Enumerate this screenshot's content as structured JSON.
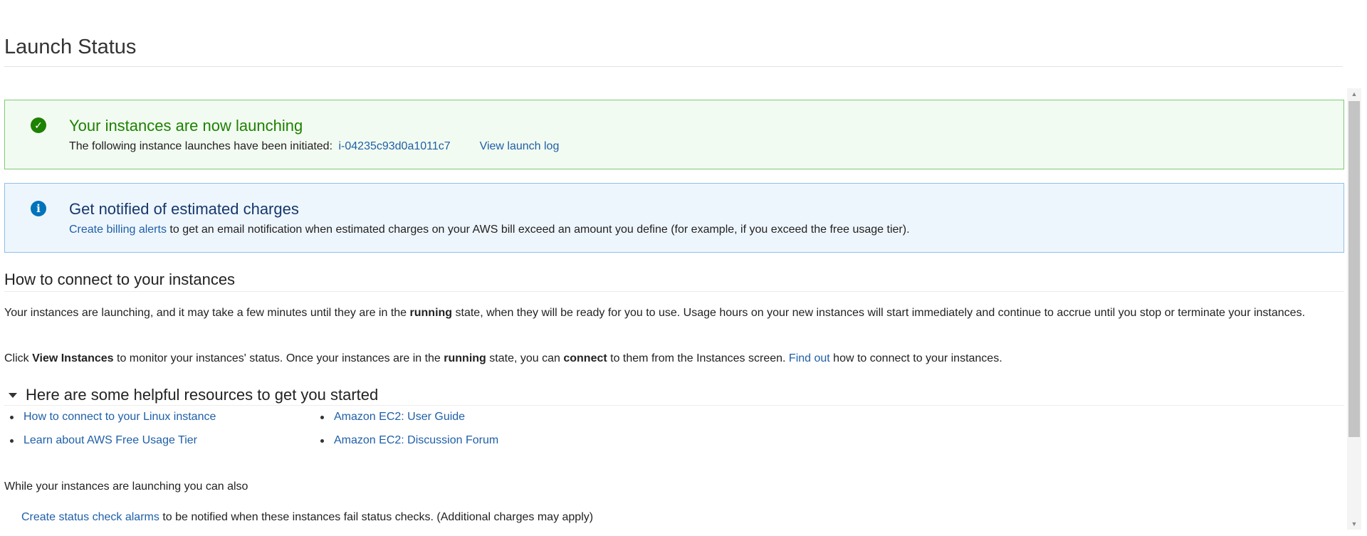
{
  "page": {
    "title": "Launch Status"
  },
  "success_alert": {
    "icon": "check-circle-icon",
    "title": "Your instances are now launching",
    "body_text": "The following instance launches have been initiated:",
    "instance_id": "i-04235c93d0a1011c7",
    "view_log_label": "View launch log",
    "color": "#1d8102"
  },
  "info_alert": {
    "icon": "info-circle-icon",
    "title": "Get notified of estimated charges",
    "link_label": "Create billing alerts",
    "body_text": "to get an email notification when estimated charges on your AWS bill exceed an amount you define (for example, if you exceed the free usage tier).",
    "color": "#0073bb"
  },
  "connect_section": {
    "title": "How to connect to your instances",
    "para1": {
      "part1": "Your instances are launching, and it may take a few minutes until they are in the ",
      "bold1": "running",
      "part2": " state, when they will be ready for you to use. Usage hours on your new instances will start immediately and continue to accrue until you stop or terminate your instances."
    },
    "para2": {
      "part1": "Click ",
      "bold1": "View Instances",
      "part2": " to monitor your instances' status. Once your instances are in the ",
      "bold2": "running",
      "part3": " state, you can ",
      "bold3": "connect",
      "part4": " to them from the Instances screen. ",
      "link": "Find out",
      "part5": " how to connect to your instances."
    }
  },
  "resources": {
    "title": "Here are some helpful resources to get you started",
    "col1": [
      "How to connect to your Linux instance",
      "Learn about AWS Free Usage Tier"
    ],
    "col2": [
      "Amazon EC2: User Guide",
      "Amazon EC2: Discussion Forum"
    ]
  },
  "also": {
    "text": "While your instances are launching you can also",
    "alarm_link": "Create status check alarms",
    "alarm_text": "to be notified when these instances fail status checks. (Additional charges may apply)"
  }
}
